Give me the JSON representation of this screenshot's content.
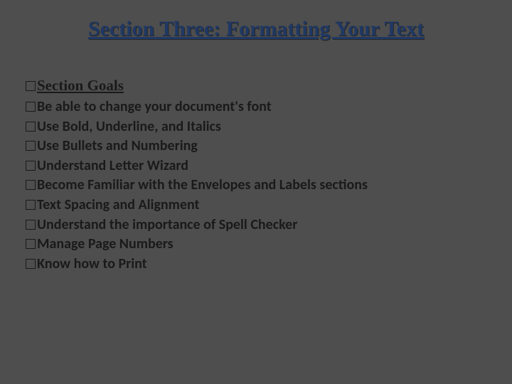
{
  "title": "Section Three: Formatting Your Text",
  "goals_label": "Section Goals",
  "items": [
    "Be able to change your document's font",
    "Use Bold, Underline, and Italics",
    "Use Bullets and Numbering",
    "Understand Letter Wizard",
    "Become Familiar with the Envelopes and Labels sections",
    "Text Spacing and Alignment",
    "Understand the importance of Spell Checker",
    "Manage Page Numbers",
    "Know how to Print"
  ]
}
